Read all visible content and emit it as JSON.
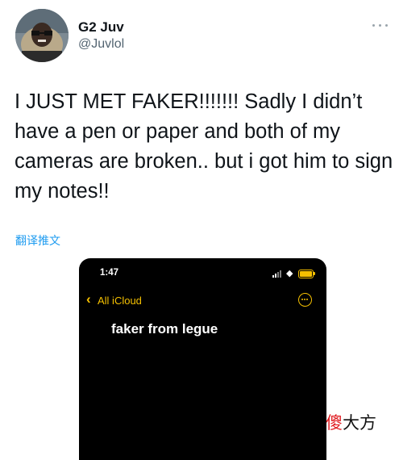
{
  "tweet": {
    "author_name": "G2 Juv",
    "author_handle": "@Juvlol",
    "text": "I JUST MET FAKER!!!!!!! Sadly I didn’t have a pen or paper and both of my cameras are broken.. but i got him to sign my notes!!",
    "translate_label": "翻译推文",
    "more_icon": "more-horizontal-icon"
  },
  "attachment": {
    "status_time": "1:47",
    "back_label": "All iCloud",
    "note_title": "faker from legue",
    "accent_color": "#f5c000",
    "background_color": "#000000"
  },
  "watermark": {
    "first_char": "傻",
    "rest": "大方"
  },
  "colors": {
    "text": "#0f1419",
    "secondary_text": "#536471",
    "link": "#1d9bf0"
  }
}
